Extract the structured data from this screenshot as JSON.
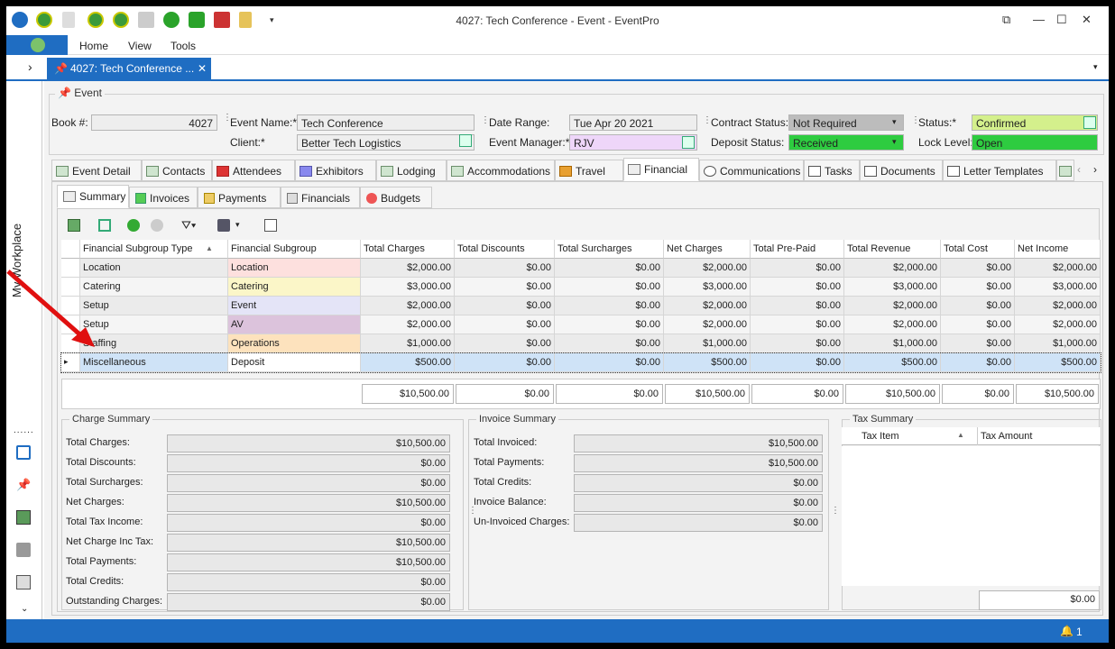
{
  "window": {
    "title": "4027: Tech Conference - Event - EventPro"
  },
  "ribbon": {
    "menus": [
      "Home",
      "View",
      "Tools"
    ]
  },
  "document_tab": {
    "label": "4027: Tech Conference ..."
  },
  "sidebar": {
    "label": "My Workplace"
  },
  "event_group": {
    "label": "Event"
  },
  "header": {
    "book_label": "Book #:",
    "book_value": "4027",
    "event_name_label": "Event Name:*",
    "event_name_value": "Tech Conference",
    "client_label": "Client:*",
    "client_value": "Better Tech Logistics",
    "date_range_label": "Date Range:",
    "date_range_value": "Tue Apr 20 2021",
    "event_manager_label": "Event Manager:*",
    "event_manager_value": "RJV",
    "contract_status_label": "Contract Status:",
    "contract_status_value": "Not Required",
    "deposit_status_label": "Deposit Status:",
    "deposit_status_value": "Received",
    "status_label": "Status:*",
    "status_value": "Confirmed",
    "lock_level_label": "Lock Level:",
    "lock_level_value": "Open"
  },
  "main_tabs": [
    "Event Detail",
    "Contacts",
    "Attendees",
    "Exhibitors",
    "Lodging",
    "Accommodations",
    "Travel",
    "Financial",
    "Communications",
    "Tasks",
    "Documents",
    "Letter Templates"
  ],
  "sub_tabs": [
    "Summary",
    "Invoices",
    "Payments",
    "Financials",
    "Budgets"
  ],
  "grid": {
    "columns": [
      "Financial Subgroup Type",
      "Financial Subgroup",
      "Total Charges",
      "Total Discounts",
      "Total Surcharges",
      "Net Charges",
      "Total Pre-Paid",
      "Total Revenue",
      "Total Cost",
      "Net Income"
    ],
    "rows": [
      [
        "Location",
        "Location",
        "$2,000.00",
        "$0.00",
        "$0.00",
        "$2,000.00",
        "$0.00",
        "$2,000.00",
        "$0.00",
        "$2,000.00"
      ],
      [
        "Catering",
        "Catering",
        "$3,000.00",
        "$0.00",
        "$0.00",
        "$3,000.00",
        "$0.00",
        "$3,000.00",
        "$0.00",
        "$3,000.00"
      ],
      [
        "Setup",
        "Event",
        "$2,000.00",
        "$0.00",
        "$0.00",
        "$2,000.00",
        "$0.00",
        "$2,000.00",
        "$0.00",
        "$2,000.00"
      ],
      [
        "Setup",
        "AV",
        "$2,000.00",
        "$0.00",
        "$0.00",
        "$2,000.00",
        "$0.00",
        "$2,000.00",
        "$0.00",
        "$2,000.00"
      ],
      [
        "Staffing",
        "Operations",
        "$1,000.00",
        "$0.00",
        "$0.00",
        "$1,000.00",
        "$0.00",
        "$1,000.00",
        "$0.00",
        "$1,000.00"
      ],
      [
        "Miscellaneous",
        "Deposit",
        "$500.00",
        "$0.00",
        "$0.00",
        "$500.00",
        "$0.00",
        "$500.00",
        "$0.00",
        "$500.00"
      ]
    ],
    "row_colors": [
      "#fde0de",
      "#fbf6c8",
      "#e4e4f7",
      "#dcc3dc",
      "#fde2bd",
      "#ffffff"
    ],
    "totals": [
      "$10,500.00",
      "$0.00",
      "$0.00",
      "$10,500.00",
      "$0.00",
      "$10,500.00",
      "$0.00",
      "$10,500.00"
    ]
  },
  "charge_summary": {
    "title": "Charge Summary",
    "items": [
      {
        "label": "Total Charges:",
        "value": "$10,500.00"
      },
      {
        "label": "Total Discounts:",
        "value": "$0.00"
      },
      {
        "label": "Total Surcharges:",
        "value": "$0.00"
      },
      {
        "label": "Net Charges:",
        "value": "$10,500.00"
      },
      {
        "label": "Total Tax Income:",
        "value": "$0.00"
      },
      {
        "label": "Net Charge Inc Tax:",
        "value": "$10,500.00"
      },
      {
        "label": "Total Payments:",
        "value": "$10,500.00"
      },
      {
        "label": "Total Credits:",
        "value": "$0.00"
      },
      {
        "label": "Outstanding Charges:",
        "value": "$0.00"
      }
    ]
  },
  "invoice_summary": {
    "title": "Invoice Summary",
    "items": [
      {
        "label": "Total Invoiced:",
        "value": "$10,500.00"
      },
      {
        "label": "Total Payments:",
        "value": "$10,500.00"
      },
      {
        "label": "Total Credits:",
        "value": "$0.00"
      },
      {
        "label": "Invoice Balance:",
        "value": "$0.00"
      },
      {
        "label": "Un-Invoiced Charges:",
        "value": "$0.00"
      }
    ]
  },
  "tax_summary": {
    "title": "Tax Summary",
    "columns": [
      "Tax Item",
      "Tax Amount"
    ],
    "total": "$0.00"
  },
  "statusbar": {
    "notifications": "1"
  },
  "colors": {
    "accent": "#1f6dc2",
    "green": "#2ecc40",
    "lightgreen": "#d4f08c",
    "lavender": "#eed6f9"
  }
}
